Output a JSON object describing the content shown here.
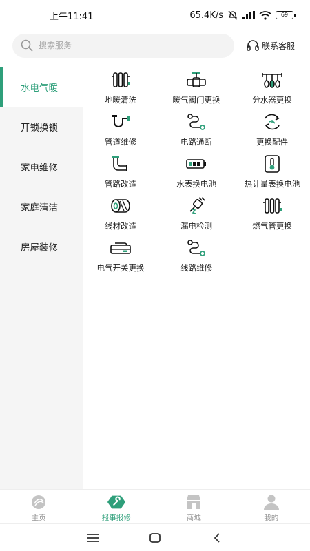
{
  "status_bar": {
    "time": "上午11:41",
    "net_speed": "65.4K/s",
    "battery": "69"
  },
  "header": {
    "search_placeholder": "搜索服务",
    "service_link_label": "联系客服",
    "search_icon": "search-icon",
    "service_icon": "headset-icon"
  },
  "sidebar": {
    "items": [
      {
        "label": "水电气暖",
        "active": true
      },
      {
        "label": "开锁换锁",
        "active": false
      },
      {
        "label": "家电维修",
        "active": false
      },
      {
        "label": "家庭清洁",
        "active": false
      },
      {
        "label": "房屋装修",
        "active": false
      }
    ]
  },
  "services": [
    {
      "label": "地暖清洗",
      "icon": "radiator-icon"
    },
    {
      "label": "暖气阀门更换",
      "icon": "valve-icon"
    },
    {
      "label": "分水器更换",
      "icon": "manifold-icon"
    },
    {
      "label": "管道维修",
      "icon": "pipe-trap-icon"
    },
    {
      "label": "电路通断",
      "icon": "circuit-icon"
    },
    {
      "label": "更换配件",
      "icon": "swap-icon"
    },
    {
      "label": "管路改造",
      "icon": "pipe-elbow-icon"
    },
    {
      "label": "水表换电池",
      "icon": "battery-icon"
    },
    {
      "label": "热计量表换电池",
      "icon": "thermometer-icon"
    },
    {
      "label": "线材改造",
      "icon": "cable-roll-icon"
    },
    {
      "label": "漏电检测",
      "icon": "electric-plug-icon"
    },
    {
      "label": "燃气管更换",
      "icon": "gas-pipe-icon"
    },
    {
      "label": "电气开关更换",
      "icon": "switch-box-icon"
    },
    {
      "label": "线路维修",
      "icon": "wire-icon"
    }
  ],
  "tabbar": {
    "tabs": [
      {
        "label": "主页",
        "icon": "home-icon",
        "active": false
      },
      {
        "label": "报事报修",
        "icon": "wrench-icon",
        "active": true
      },
      {
        "label": "商城",
        "icon": "shop-icon",
        "active": false
      },
      {
        "label": "我的",
        "icon": "user-icon",
        "active": false
      }
    ]
  },
  "colors": {
    "accent": "#2e9f7a",
    "sidebar_bg": "#f5f5f5",
    "inactive_tab": "#bdbdbd"
  }
}
